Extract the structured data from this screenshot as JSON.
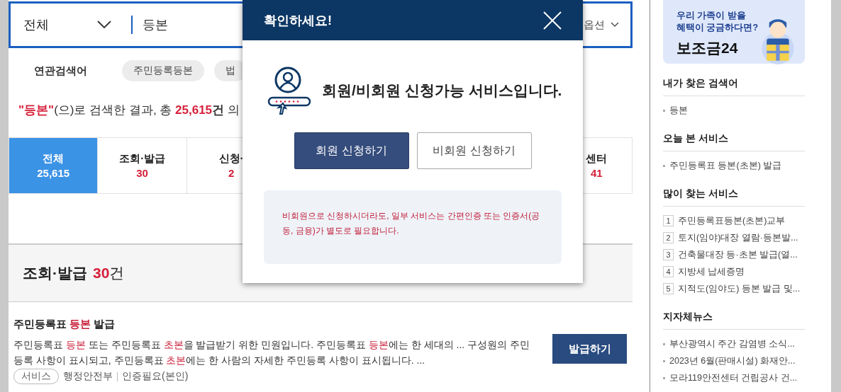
{
  "search": {
    "scope": "전체",
    "query": "등본",
    "options_label": "옵션"
  },
  "related": {
    "label": "연관검색어",
    "chips": [
      "주민등록등본",
      "법"
    ]
  },
  "summary": {
    "query": "\"등본\"",
    "middle": "(으)로 검색한 결과, 총 ",
    "count": "25,615",
    "unit": "건",
    "tail": " 의"
  },
  "categories": [
    {
      "label": "전체",
      "count": "25,615",
      "selected": true
    },
    {
      "label": "조회·발급",
      "count": "30",
      "selected": false
    },
    {
      "label": "신청·",
      "count": "2",
      "selected": false
    },
    {
      "label": "센터",
      "count": "41",
      "selected": false
    }
  ],
  "section": {
    "title": "조회·발급",
    "count": "30",
    "unit": "건"
  },
  "results": [
    {
      "title": [
        {
          "text": "주민등록표 ",
          "highlight": false
        },
        {
          "text": "등본",
          "highlight": true
        },
        {
          "text": " 발급",
          "highlight": false
        }
      ],
      "description": [
        {
          "text": "주민등록표 ",
          "highlight": false
        },
        {
          "text": "등본",
          "highlight": true
        },
        {
          "text": " 또는 주민등록표 ",
          "highlight": false
        },
        {
          "text": "초본",
          "highlight": true
        },
        {
          "text": "을 발급받기 위한 민원입니다. 주민등록표 ",
          "highlight": false
        },
        {
          "text": "등본",
          "highlight": true
        },
        {
          "text": "에는 한 세대의 ... 구성원의 주민 등록 사항이 표시되고, 주민등록표 ",
          "highlight": false
        },
        {
          "text": "초본",
          "highlight": true
        },
        {
          "text": "에는 한 사람의 자세한 주민등록 사항이 표시됩니다. ...",
          "highlight": false
        }
      ],
      "action": "발급하기",
      "type": "서비스",
      "agency": "행정안전부",
      "auth": "인증필요(본인)"
    }
  ],
  "sidebar": {
    "banner": {
      "line1": "우리 가족이 받을",
      "line2": "혜택이 궁금하다면?",
      "brand": "보조금24"
    },
    "recent_searches": {
      "title": "내가 찾은 검색어",
      "items": [
        "등본"
      ]
    },
    "recent_services": {
      "title": "오늘 본 서비스",
      "items": [
        "주민등록표 등본(초본) 발급"
      ]
    },
    "popular": {
      "title": "많이 찾는 서비스",
      "items": [
        {
          "rank": "1",
          "label": "주민등록표등본(초본)교부"
        },
        {
          "rank": "2",
          "label": "토지(임야)대장 열람·등본발..."
        },
        {
          "rank": "3",
          "label": "건축물대장 등·초본 발급(열..."
        },
        {
          "rank": "4",
          "label": "지방세 납세증명"
        },
        {
          "rank": "5",
          "label": "지적도(임야도) 등본 발급 및..."
        }
      ]
    },
    "news": {
      "title": "지자체뉴스",
      "items": [
        "부산광역시 주간 감염병 소식...",
        "2023년 6월(판매시설) 화재안...",
        "모라119안전센터 건립공사 건..."
      ]
    }
  },
  "modal": {
    "title": "확인하세요!",
    "message": "회원/비회원 신청가능 서비스입니다.",
    "buttons": [
      {
        "label": "회원 신청하기",
        "primary": true
      },
      {
        "label": "비회원 신청하기",
        "primary": false
      }
    ],
    "notice": "비회원으로 신청하시더라도, 일부 서비스는 간편인증 또는 인증서(공동, 금융)가 별도로 필요합니다."
  }
}
